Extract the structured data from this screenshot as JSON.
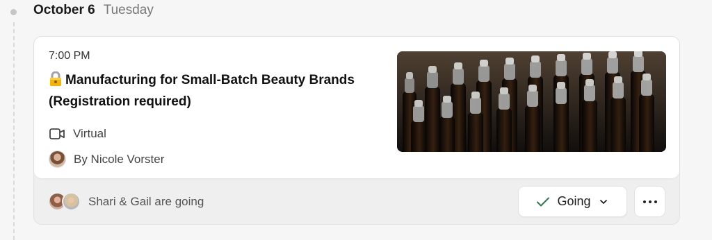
{
  "date_header": {
    "date": "October 6",
    "weekday": "Tuesday"
  },
  "event": {
    "time": "7:00 PM",
    "title_line1": "Manufacturing for Small-Batch Beauty Brands",
    "title_line2": "(Registration required)",
    "title_icon": "lock-emoji-icon",
    "location": "Virtual",
    "location_icon": "video-camera-icon",
    "host": "By Nicole Vorster",
    "image_description_icon": "event-cover-image"
  },
  "rsvp": {
    "attendees_text": "Shari & Gail are going",
    "going_label": "Going",
    "going_icon": "check-icon",
    "dropdown_icon": "chevron-down-icon",
    "more_icon": "more-options-icon"
  },
  "colors": {
    "background": "#f6f6f6",
    "card": "#ffffff",
    "footer": "#efefef",
    "check": "#2c7b4c"
  }
}
